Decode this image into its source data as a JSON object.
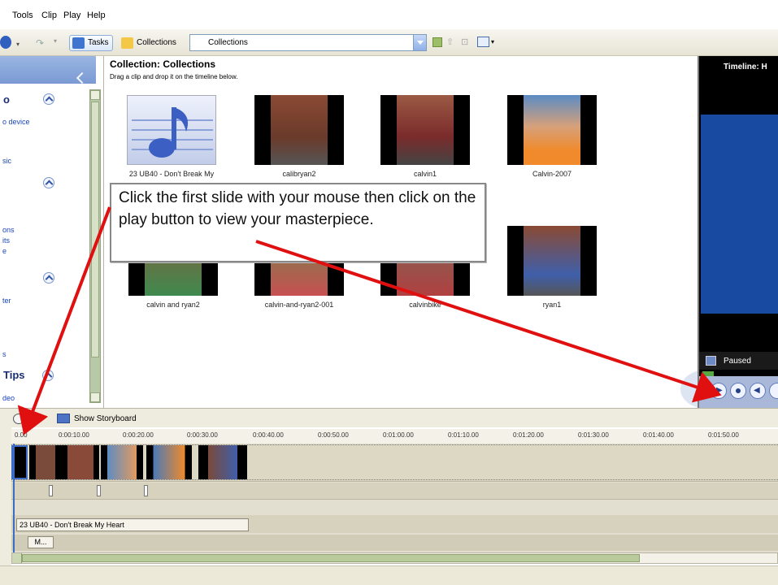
{
  "menu": {
    "items": [
      "Tools",
      "Clip",
      "Play",
      "Help"
    ]
  },
  "toolbar": {
    "tasks_label": "Tasks",
    "collections_label": "Collections",
    "combo_value": "Collections"
  },
  "left_panel": {
    "section_1": "o",
    "link_1": "o device",
    "link_2": "sic",
    "link_3": "ons",
    "link_4": "its",
    "link_5": "e",
    "link_6": "ter",
    "link_7": "s",
    "tips_heading": "Tips",
    "tips_link": "deo"
  },
  "collection": {
    "title": "Collection: Collections",
    "subtitle": "Drag a clip and drop it on the timeline below.",
    "clips": [
      {
        "label": "23 UB40 - Don't Break My"
      },
      {
        "label": "calibryan2"
      },
      {
        "label": "calvin1"
      },
      {
        "label": "Calvin-2007"
      },
      {
        "label": "calvin and ryan2"
      },
      {
        "label": "calvin-and-ryan2-001"
      },
      {
        "label": "calvinbike"
      },
      {
        "label": "ryan1"
      }
    ]
  },
  "callout": {
    "text": "Click the first slide with your mouse then click on the play button to view your masterpiece."
  },
  "preview": {
    "title": "Timeline: H",
    "status": "Paused"
  },
  "timeline": {
    "show_storyboard": "Show Storyboard",
    "ruler": [
      "0.00",
      "0:00:10.00",
      "0:00:20.00",
      "0:00:30.00",
      "0:00:40.00",
      "0:00:50.00",
      "0:01:00.00",
      "0:01:10.00",
      "0:01:20.00",
      "0:01:30.00",
      "0:01:40.00",
      "0:01:50.00"
    ],
    "audio_clip": "23 UB40 - Don't Break My Heart",
    "music_clip": "M..."
  },
  "colors": {
    "accent_blue": "#174aa0",
    "arrow_red": "#e01010",
    "panel_blue": "#7b9ad4"
  }
}
